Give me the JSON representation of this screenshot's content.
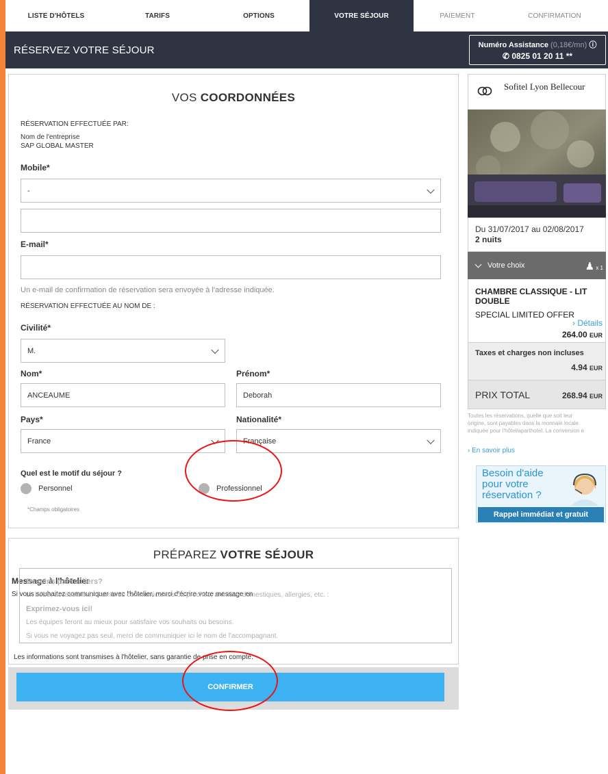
{
  "steps": [
    "LISTE D'HÔTELS",
    "TARIFS",
    "OPTIONS",
    "VOTRE SÉJOUR",
    "PAIEMENT",
    "CONFIRMATION"
  ],
  "header": {
    "title": "RÉSERVEZ VOTRE SÉJOUR",
    "assist_label": "Numéro Assistance",
    "assist_rate": "(0,18€/mn)",
    "assist_info_icon": "ⓘ",
    "assist_phone": "0825 01 20 11 **"
  },
  "contact": {
    "title_light": "VOS ",
    "title_bold": "COORDONNÉES",
    "booked_by": "RÉSERVATION EFFECTUÉE PAR:",
    "company_label": "Nom de l'entreprise",
    "company_value": "SAP GLOBAL MASTER",
    "mobile_label": "Mobile*",
    "mobile_prefix_value": "-",
    "mobile_number_value": "",
    "email_label": "E-mail*",
    "email_value": "",
    "email_note": "Un e-mail de confirmation de réservation sera envoyée à l'adresse indiquée.",
    "booked_for": "RÉSERVATION EFFECTUÉE AU NOM DE :",
    "civility_label": "Civilité*",
    "civility_value": "M.",
    "lastname_label": "Nom*",
    "lastname_value": "ANCEAUME",
    "firstname_label": "Prénom*",
    "firstname_value": "Deborah",
    "country_label": "Pays*",
    "country_value": "France",
    "nationality_label": "Nationalité*",
    "nationality_value": "Française",
    "purpose_label": "Quel est le motif du séjour ?",
    "purpose_personal": "Personnel",
    "purpose_professional": "Professionnel",
    "required_note": "*Champs obligatoires"
  },
  "prepare": {
    "title_light": "PRÉPAREZ ",
    "title_bold": "VOTRE SÉJOUR",
    "message_label": "Message à l'hôtelier",
    "message_intro": "Si vous souhaitez communiquer avec l'hôtelier, merci d'écrire votre message en",
    "placeholder_lines": [
      "Besoins particuliers?",
      "Lit bébé, accessibilité, chambres communicantes ou proches, animaux domestiques, allergies, etc. :",
      "Exprimez-vous ici!",
      "Les équipes feront au mieux pour satisfaire vos souhaits ou besoins.",
      "Si vous ne voyagez pas seul, merci de communiquer ici le nom de l'accompagnant."
    ],
    "disclaimer": "Les informations sont transmises à l'hôtelier, sans garantie de prise en compte."
  },
  "confirm_label": "CONFIRMER",
  "sidebar": {
    "hotel_name": "Sofitel Lyon Bellecour",
    "dates": "Du 31/07/2017 au 02/08/2017",
    "nights": "2 nuits",
    "choice_label": "Votre choix",
    "persons": "x 1",
    "room_type": "CHAMBRE CLASSIQUE - LIT DOUBLE",
    "offer": "SPECIAL LIMITED OFFER",
    "details_link": "Détails",
    "room_price": "264.00",
    "currency": "EUR",
    "taxes_label": "Taxes et charges non incluses",
    "taxes_value": "4.94",
    "total_label": "PRIX TOTAL",
    "total_value": "268.94",
    "pay_info_1": "Toutes les réservations, quelle que soit leur",
    "pay_info_2": "origine, sont payables dans la monnaie locale",
    "pay_info_3": "indiquée pour l'hôtel/aparthotel. La conversion e",
    "more_link": "En savoir plus",
    "help_line1": "Besoin d'aide",
    "help_line2": "pour votre",
    "help_line3": "réservation ?",
    "help_button": "Rappel immédiat et gratuit"
  },
  "colors": {
    "frame": "#f3843a",
    "header": "#2f3442",
    "confirm": "#3db2f3",
    "link": "#3a9ad9",
    "annotation": "#ee1111"
  }
}
